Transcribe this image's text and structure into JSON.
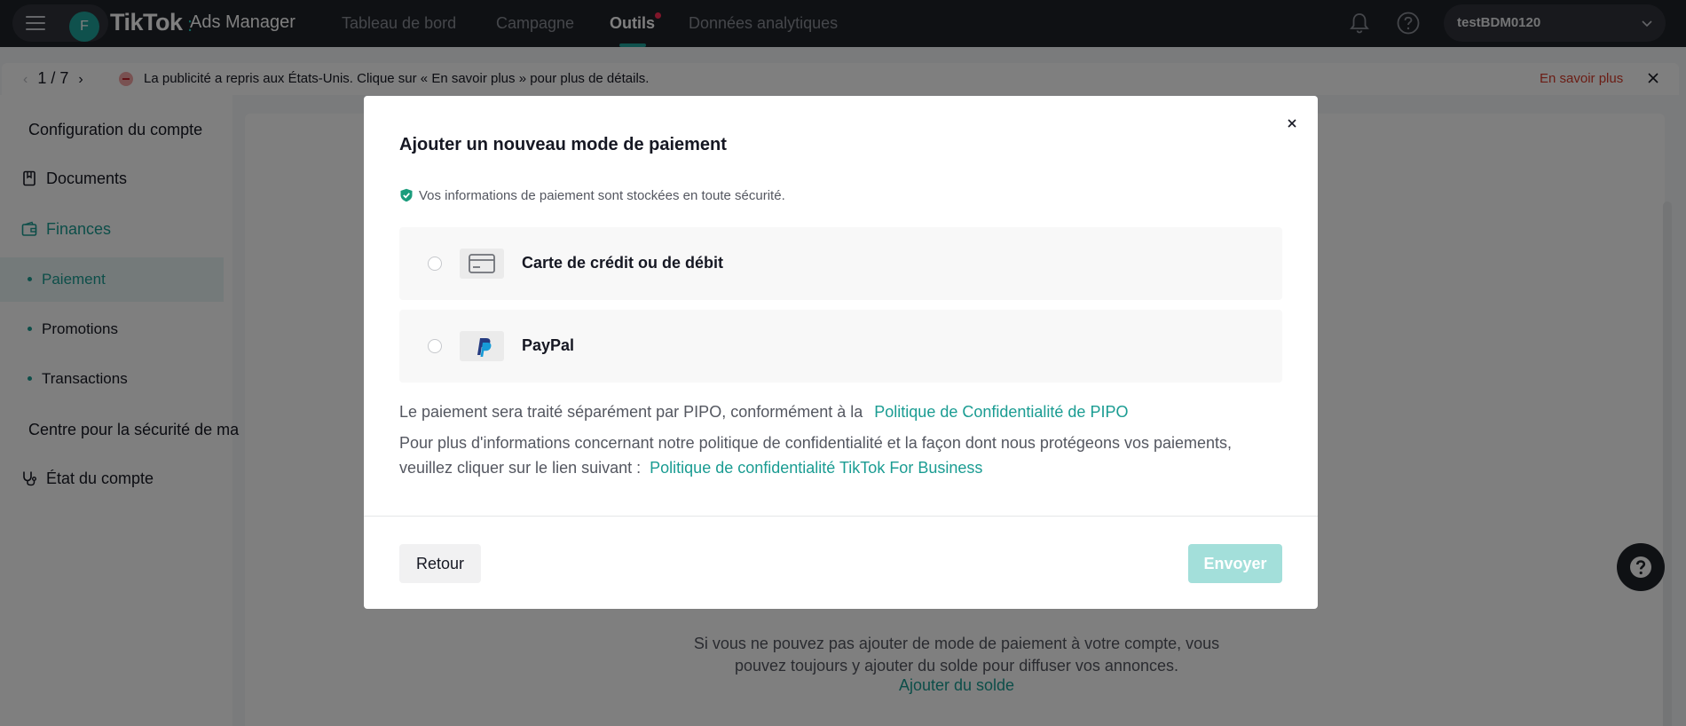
{
  "topnav": {
    "avatar_letter": "F",
    "brand": "TikTok",
    "brand_sub": "Ads Manager",
    "items": [
      {
        "label": "Tableau de bord"
      },
      {
        "label": "Campagne"
      },
      {
        "label": "Outils"
      },
      {
        "label": "Données analytiques"
      }
    ],
    "account_name": "testBDM0120",
    "accent": "#1fa39a"
  },
  "notice": {
    "pager": "1 / 7",
    "text": "La publicité a repris aux États-Unis. Clique sur « En savoir plus » pour plus de détails.",
    "link": "En savoir plus"
  },
  "sidebar": {
    "section_account": "Configuration du compte",
    "documents": "Documents",
    "finances": "Finances",
    "sub_items": [
      {
        "label": "Paiement"
      },
      {
        "label": "Promotions"
      },
      {
        "label": "Transactions"
      }
    ],
    "section_security": "Centre pour la sécurité de ma",
    "account_status": "État du compte"
  },
  "main": {
    "info_line1": "Si vous ne pouvez pas ajouter de mode de paiement à votre compte, vous",
    "info_line2": "pouvez toujours y ajouter du solde pour diffuser vos annonces.",
    "add_balance": "Ajouter du solde"
  },
  "modal": {
    "title": "Ajouter un nouveau mode de paiement",
    "secure_note": "Vos informations de paiement sont stockées en toute sécurité.",
    "options": [
      {
        "label": "Carte de crédit ou de débit",
        "icon": "credit-card-icon"
      },
      {
        "label": "PayPal",
        "icon": "paypal-icon"
      }
    ],
    "para1_text": "Le paiement sera traité séparément par PIPO, conformément à la",
    "para1_link": "Politique de Confidentialité de PIPO",
    "para2_line1": "Pour plus d'informations concernant notre politique de confidentialité et la façon dont nous protégeons vos paiements,",
    "para2_line2": "veuillez cliquer sur le lien suivant :",
    "para2_link": "Politique de confidentialité TikTok For Business",
    "back_label": "Retour",
    "send_label": "Envoyer"
  }
}
